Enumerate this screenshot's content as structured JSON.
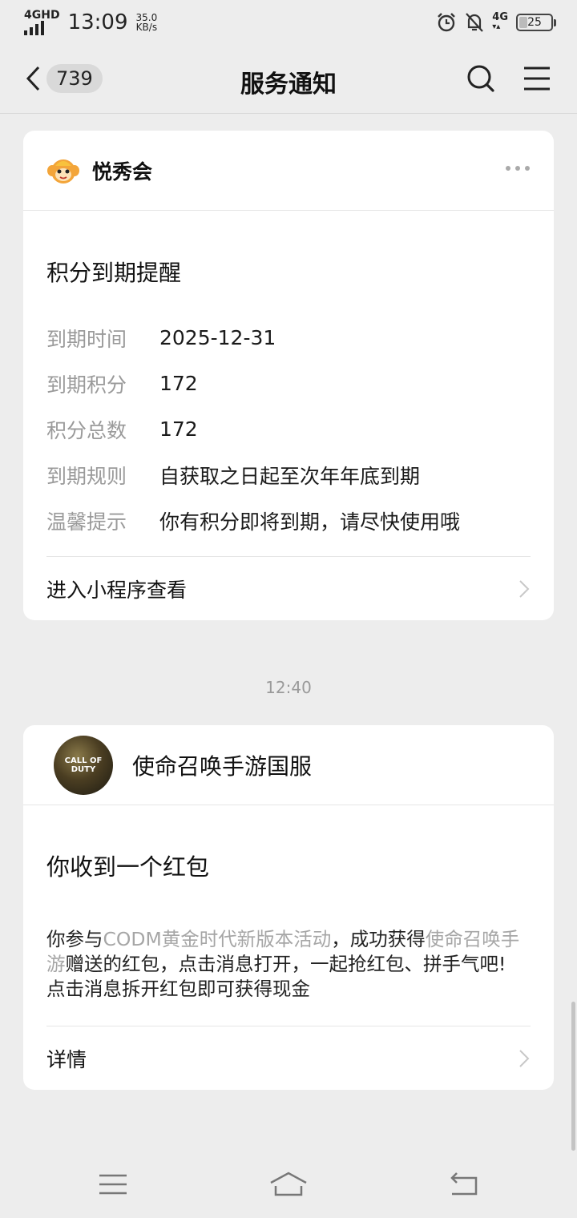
{
  "status_bar": {
    "network": "4GHD",
    "time": "13:09",
    "speed_value": "35.0",
    "speed_unit": "KB/s",
    "network_right": "4G",
    "battery": "25",
    "battery_level": 0.25
  },
  "header": {
    "unread_count": "739",
    "title": "服务通知"
  },
  "card1": {
    "sender": "悦秀会",
    "title": "积分到期提醒",
    "rows": [
      {
        "key": "到期时间",
        "value": "2025-12-31"
      },
      {
        "key": "到期积分",
        "value": "172"
      },
      {
        "key": "积分总数",
        "value": "172"
      },
      {
        "key": "到期规则",
        "value": "自获取之日起至次年年底到期"
      },
      {
        "key": "温馨提示",
        "value": "你有积分即将到期，请尽快使用哦"
      }
    ],
    "footer": "进入小程序查看"
  },
  "timestamp": "12:40",
  "card2": {
    "sender": "使命召唤手游国服",
    "avatar_text": "CALL OF DUTY",
    "title": "你收到一个红包",
    "body_1": "你参与",
    "body_hl_1": "CODM黄金时代新版本活动",
    "body_2": "，成功获得",
    "body_hl_2": "使命召唤手游",
    "body_3": "赠送的红包，点击消息打开，一起抢红包、拼手气吧!",
    "body_line2": "点击消息拆开红包即可获得现金",
    "footer": "详情"
  },
  "colors": {
    "background": "#ededed",
    "card": "#ffffff",
    "muted": "#9a9a9a",
    "highlight": "#a6a6a6"
  }
}
